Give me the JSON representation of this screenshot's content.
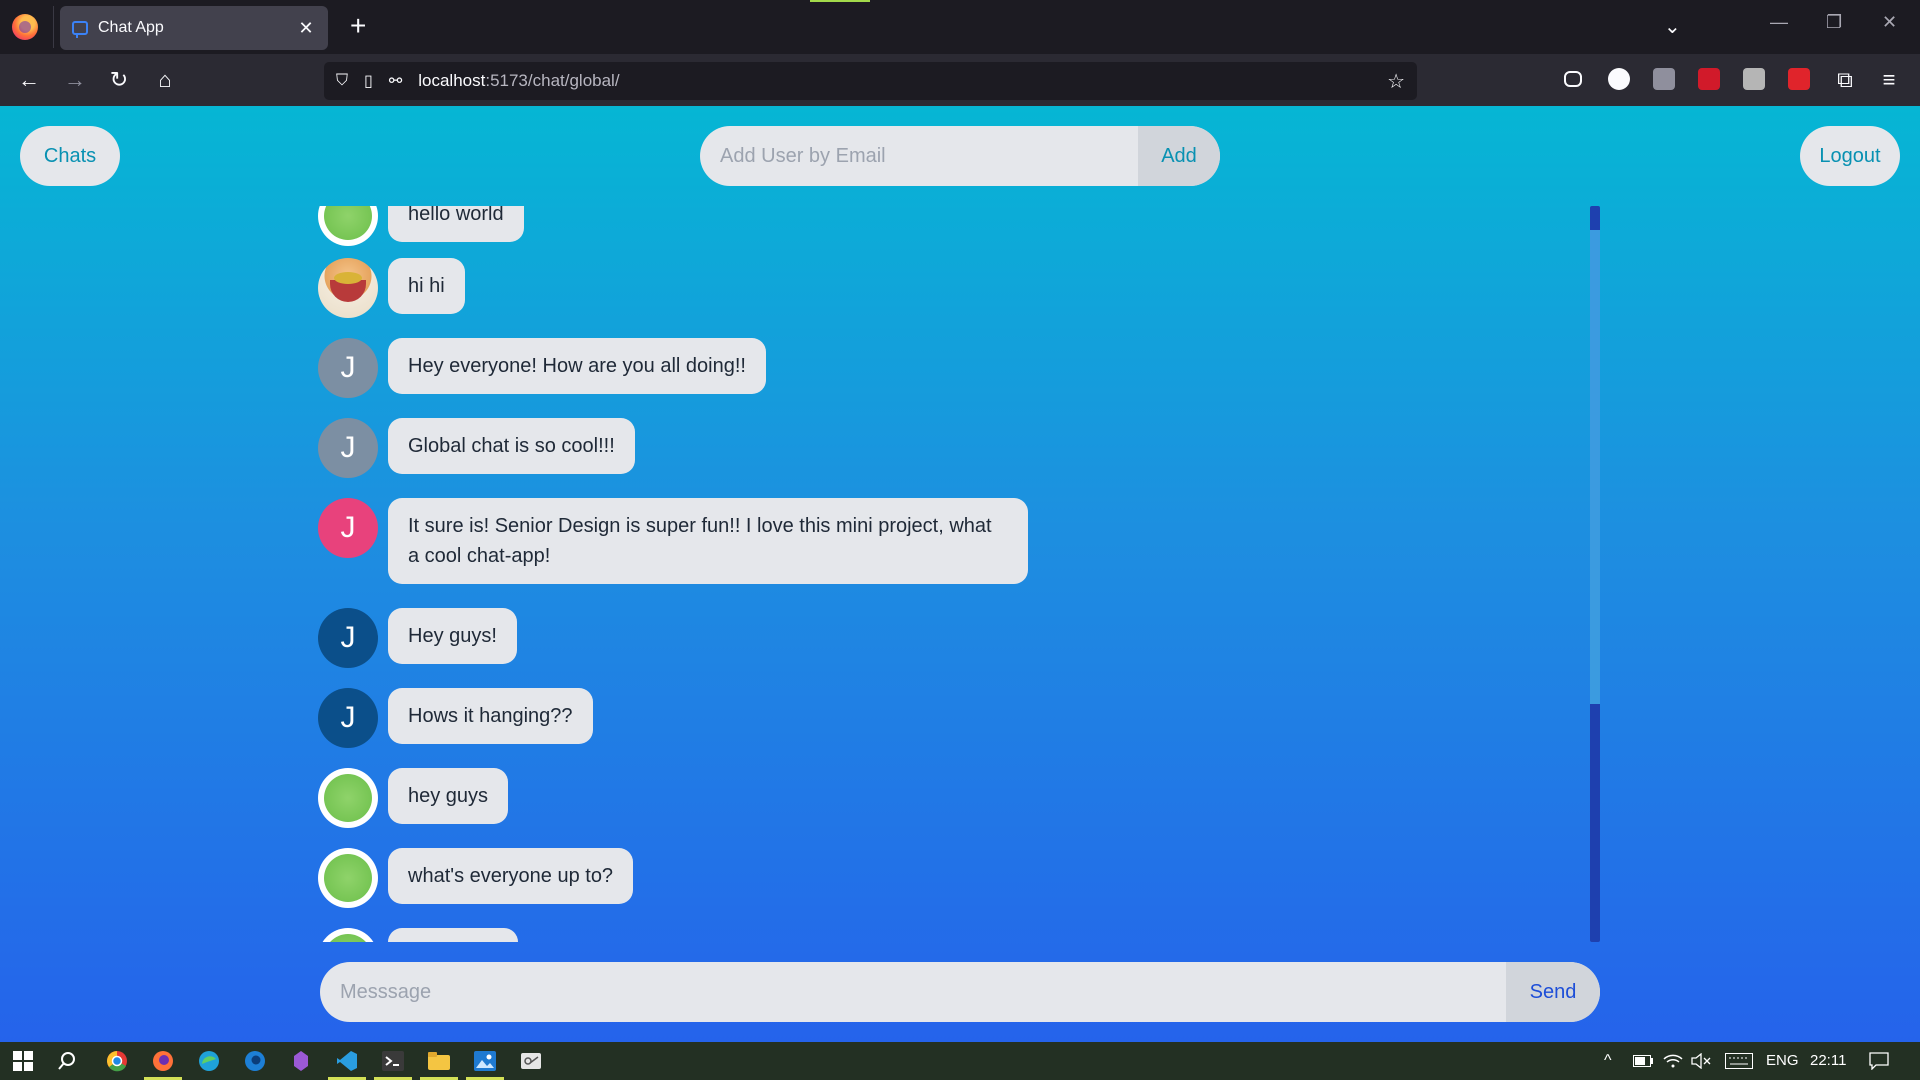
{
  "browser": {
    "tab_title": "Chat App",
    "url_host": "localhost",
    "url_path": ":5173/chat/global/"
  },
  "header": {
    "chats_label": "Chats",
    "add_user_placeholder": "Add User by Email",
    "add_label": "Add",
    "logout_label": "Logout"
  },
  "messages": [
    {
      "avatar": "green",
      "initial": "",
      "text": "hello world"
    },
    {
      "avatar": "basket",
      "initial": "",
      "text": "hi hi"
    },
    {
      "avatar": "grey",
      "initial": "J",
      "text": "Hey everyone! How are you all doing!!"
    },
    {
      "avatar": "grey",
      "initial": "J",
      "text": "Global chat is so cool!!!"
    },
    {
      "avatar": "pink",
      "initial": "J",
      "text": "It sure is! Senior Design is super fun!! I love this mini project, what a cool chat-app!"
    },
    {
      "avatar": "navy",
      "initial": "J",
      "text": "Hey guys!"
    },
    {
      "avatar": "navy",
      "initial": "J",
      "text": "Hows it hanging??"
    },
    {
      "avatar": "green",
      "initial": "",
      "text": "hey guys"
    },
    {
      "avatar": "green",
      "initial": "",
      "text": "what's everyone up to?"
    }
  ],
  "avatar_colors": {
    "grey": "#7c8fa3",
    "pink": "#e8427c",
    "navy": "#0b4f8a"
  },
  "composer": {
    "placeholder": "Messsage",
    "send_label": "Send"
  },
  "taskbar": {
    "language": "ENG",
    "time": "22:11"
  }
}
